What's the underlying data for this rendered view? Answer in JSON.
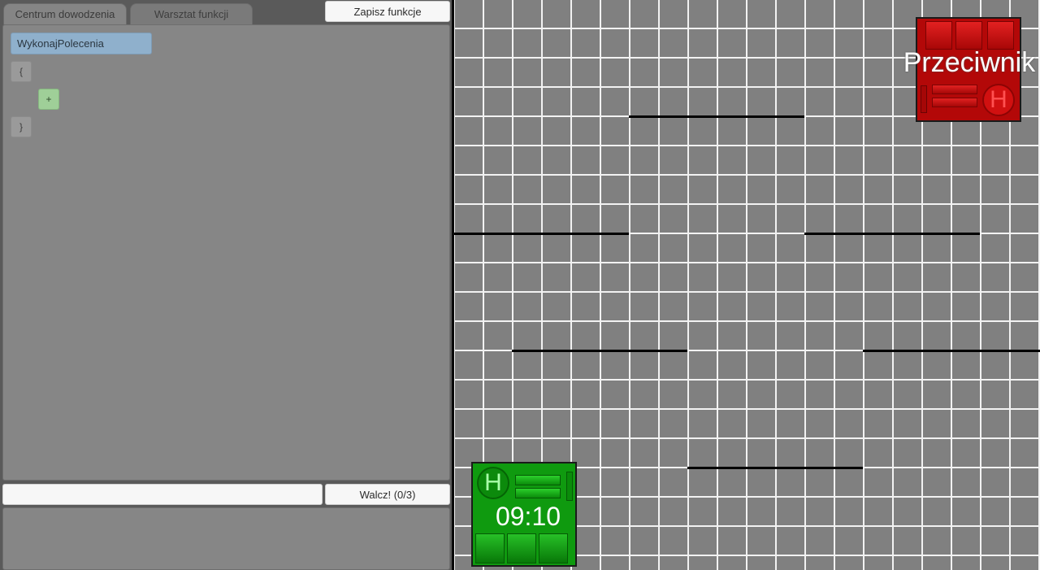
{
  "tabs": [
    {
      "label": "Centrum dowodzenia",
      "active": true
    },
    {
      "label": "Warsztat funkcji",
      "active": false
    }
  ],
  "toolbar": {
    "save_label": "Zapisz funkcje"
  },
  "editor": {
    "function_name": "WykonajPolecenia",
    "open_brace": "{",
    "add_label": "+",
    "close_brace": "}"
  },
  "bottom": {
    "command_value": "",
    "fight_label": "Walcz! (0/3)"
  },
  "enemy": {
    "label": "Przeciwnik",
    "badge": "H",
    "color": "#b30808"
  },
  "player": {
    "timer": "09:10",
    "badge": "H",
    "color": "#0f9a0f"
  },
  "colors": {
    "grid_line": "#f2f2f2",
    "board_bg": "#808080",
    "wall": "#000000"
  }
}
